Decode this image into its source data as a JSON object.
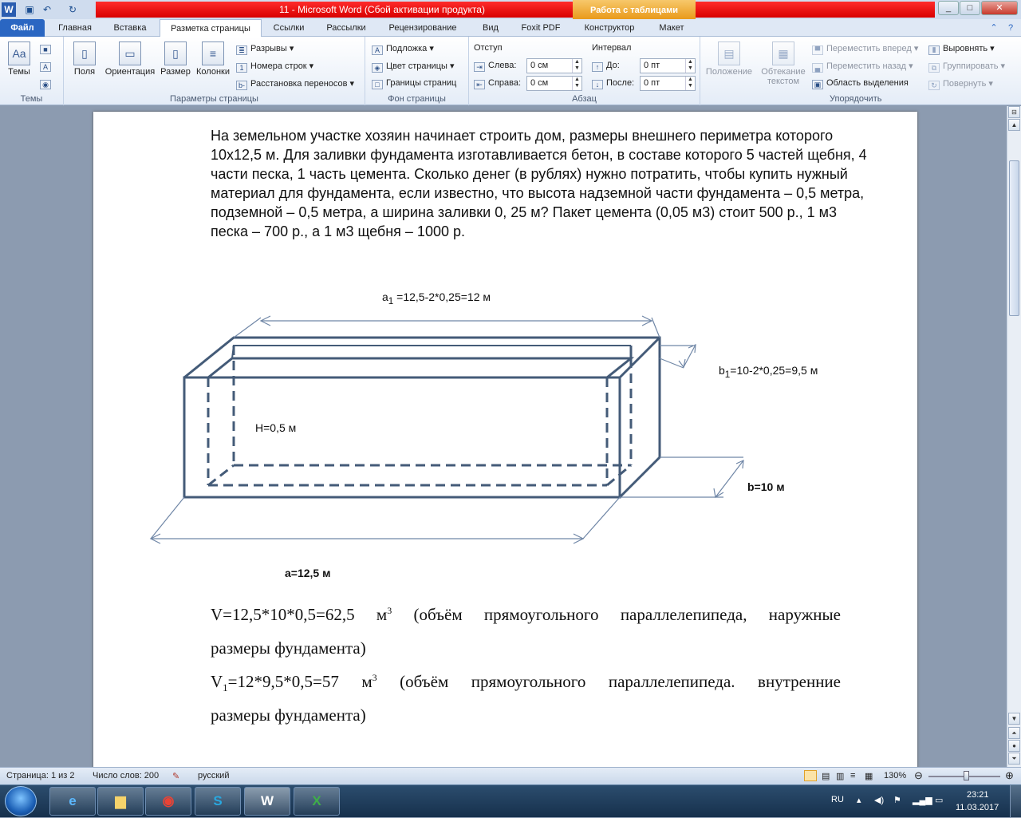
{
  "window": {
    "title": "11 - Microsoft Word (Сбой активации продукта)",
    "context_tab": "Работа с таблицами",
    "quick_access": [
      "save-icon",
      "undo-icon",
      "redo-icon"
    ],
    "controls": [
      "_",
      "□",
      "✕"
    ]
  },
  "tabs": [
    "Файл",
    "Главная",
    "Вставка",
    "Разметка страницы",
    "Ссылки",
    "Рассылки",
    "Рецензирование",
    "Вид",
    "Foxit PDF",
    "Конструктор",
    "Макет"
  ],
  "ribbon": {
    "themes": {
      "button": "Темы",
      "group": "Темы"
    },
    "page_setup": {
      "margins": "Поля",
      "orientation": "Ориентация",
      "size": "Размер",
      "columns": "Колонки",
      "breaks": "Разрывы",
      "line_numbers": "Номера строк",
      "hyphenation": "Расстановка переносов",
      "group": "Параметры страницы"
    },
    "background": {
      "watermark": "Подложка",
      "page_color": "Цвет страницы",
      "borders": "Границы страниц",
      "group": "Фон страницы"
    },
    "paragraph": {
      "indent_label": "Отступ",
      "left_label": "Слева:",
      "left_value": "0 см",
      "right_label": "Справа:",
      "right_value": "0 см",
      "spacing_label": "Интервал",
      "before_label": "До:",
      "before_value": "0 пт",
      "after_label": "После:",
      "after_value": "0 пт",
      "group": "Абзац"
    },
    "arrange": {
      "position": "Положение",
      "wrap": "Обтекание текстом",
      "bring_forward": "Переместить вперед",
      "send_backward": "Переместить назад",
      "selection_pane": "Область выделения",
      "align": "Выровнять",
      "group_btn": "Группировать",
      "rotate": "Повернуть",
      "group": "Упорядочить"
    }
  },
  "document": {
    "problem": "На земельном участке хозяин начинает строить дом, размеры внешнего периметра которого 10х12,5 м. Для заливки фундамента изготавливается бетон, в составе которого 5 частей щебня, 4 части песка, 1 часть цемента. Сколько денег (в рублях) нужно потратить, чтобы купить нужный материал для фундамента, если известно, что высота надземной части фундамента – 0,5 метра, подземной – 0,5 метра, а ширина заливки 0, 25 м? Пакет цемента (0,05 м3) стоит 500 р., 1 м3 песка – 700 р., а 1 м3 щебня – 1000 р.",
    "labels": {
      "a1_pre": "a",
      "a1_sub": "1",
      "a1_post": " =12,5-2*0,25=12 м",
      "b1_pre": "b",
      "b1_sub": "1",
      "b1_post": "=10-2*0,25=9,5 м",
      "h": "H=0,5 м",
      "b": "b=10 м",
      "a": "a=12,5 м"
    },
    "formulas": {
      "v_words": [
        "V=12,5*10*0,5=62,5",
        "м",
        "(объём",
        "прямоугольного",
        "параллелепипеда,",
        "наружные"
      ],
      "v_sup": "3",
      "v_line2": "размеры фундамента)",
      "v1_pre": "V",
      "v1_sub": "1",
      "v1_words": [
        "=12*9,5*0,5=57",
        "м",
        "(объём",
        "прямоугольного",
        "параллелепипеда.",
        "внутренние"
      ],
      "v1_sup": "3",
      "v1_line2": "размеры фундамента)"
    }
  },
  "status": {
    "page": "Страница: 1 из 2",
    "words": "Число слов: 200",
    "language": "русский",
    "zoom": "130%"
  },
  "taskbar": {
    "lang": "RU",
    "time": "23:21",
    "date": "11.03.2017",
    "apps": [
      "ie-icon",
      "explorer-icon",
      "chrome-icon",
      "skype-icon",
      "word-icon",
      "excel-icon"
    ]
  }
}
